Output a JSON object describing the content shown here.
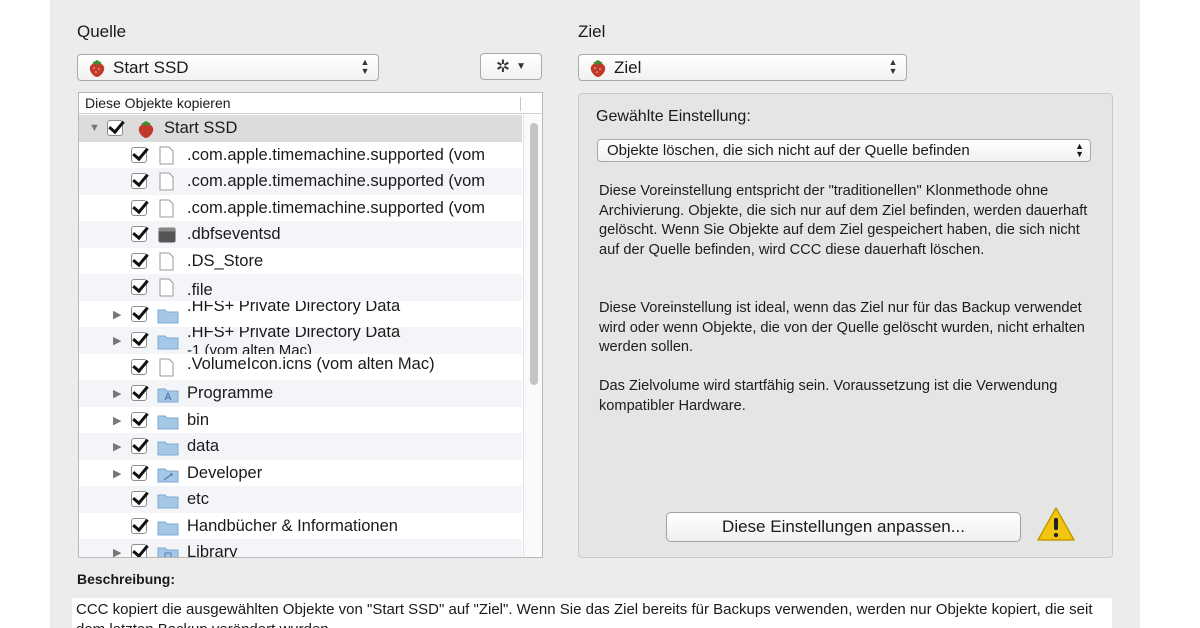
{
  "source": {
    "label": "Quelle",
    "selected": "Start SSD"
  },
  "target": {
    "label": "Ziel",
    "selected": "Ziel"
  },
  "tree": {
    "header": "Diese Objekte kopieren",
    "rows": [
      {
        "label": "Start SSD",
        "icon": "strawberry-volume-icon"
      },
      {
        "label": ".com.apple.timemachine.supported (vom",
        "icon": "document-icon"
      },
      {
        "label": ".com.apple.timemachine.supported (vom",
        "icon": "document-icon"
      },
      {
        "label": ".com.apple.timemachine.supported (vom",
        "icon": "document-icon"
      },
      {
        "label": ".dbfseventsd",
        "icon": "executable-icon"
      },
      {
        "label": ".DS_Store",
        "icon": "document-icon"
      },
      {
        "label": ".file",
        "icon": "document-icon"
      },
      {
        "label": ".HFS+ Private Directory Data",
        "icon": "folder-icon"
      },
      {
        "label": ".HFS+ Private Directory Data",
        "icon": "folder-icon"
      },
      {
        "label": "-1 (vom alten Mac)",
        "icon": "document-icon"
      },
      {
        "label": ".VolumeIcon.icns (vom alten Mac)",
        "icon": "document-icon"
      },
      {
        "label": "Programme",
        "icon": "applications-folder-icon"
      },
      {
        "label": "bin",
        "icon": "folder-icon"
      },
      {
        "label": "data",
        "icon": "folder-icon"
      },
      {
        "label": "Developer",
        "icon": "developer-folder-icon"
      },
      {
        "label": "etc",
        "icon": "folder-icon"
      },
      {
        "label": "Handbücher & Informationen",
        "icon": "folder-icon"
      },
      {
        "label": "Library",
        "icon": "library-folder-icon"
      }
    ]
  },
  "settings": {
    "title": "Gewählte Einstellung:",
    "selected": "Objekte löschen, die sich nicht auf der Quelle befinden",
    "paragraph1": "Diese Voreinstellung entspricht der \"traditionellen\" Klonmethode ohne Archivierung. Objekte, die sich nur auf dem Ziel befinden, werden dauerhaft gelöscht. Wenn Sie Objekte auf dem Ziel gespeichert haben, die sich nicht auf der Quelle befinden, wird CCC diese dauerhaft löschen.",
    "paragraph2": "Diese Voreinstellung ist ideal, wenn das Ziel nur für das Backup verwendet wird oder wenn Objekte, die von der Quelle gelöscht wurden, nicht erhalten werden sollen.",
    "paragraph3": "Das Zielvolume wird startfähig sein. Voraussetzung ist die Verwendung kompatibler Hardware.",
    "adjust_button": "Diese Einstellungen anpassen..."
  },
  "description": {
    "label": "Beschreibung:",
    "text": "CCC kopiert die ausgewählten Objekte von \"Start SSD\" auf \"Ziel\". Wenn Sie das Ziel bereits für Backups verwenden, werden nur Objekte kopiert, die seit dem letzten Backup verändert wurden."
  },
  "colors": {
    "panel": "#ececec",
    "warning": "#f2c511",
    "folder": "#a6c8e8"
  }
}
